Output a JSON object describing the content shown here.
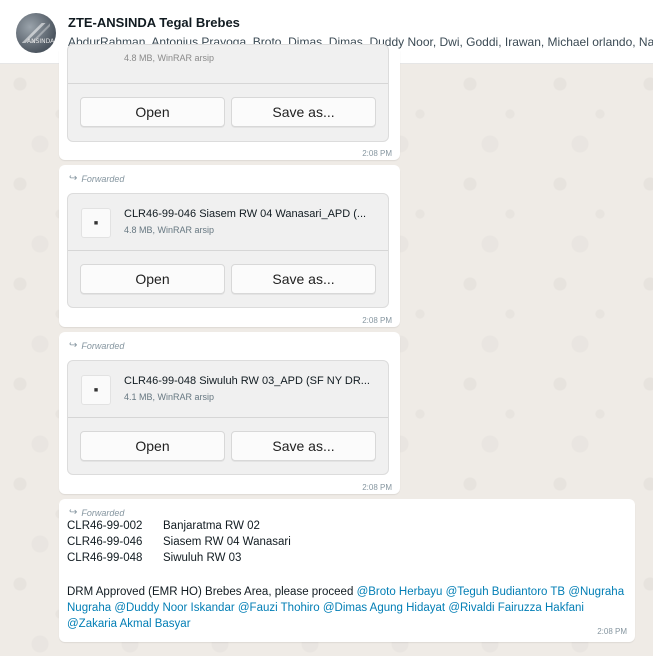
{
  "header": {
    "title": "ZTE-ANSINDA Tegal Brebes",
    "members": "AbdurRahman, Antonius Prayoga, Broto, Dimas, Dimas, Duddy Noor, Dwi, Goddi, Irawan, Michael orlando, Nad",
    "avatar_text": "ANSINDA"
  },
  "messages": [
    {
      "forwarded_label": "",
      "file_name": "",
      "file_meta": "4.8 MB, WinRAR arsip",
      "open_label": "Open",
      "save_label": "Save as...",
      "time": "2:08 PM"
    },
    {
      "forwarded_label": "Forwarded",
      "file_name": "CLR46-99-046 Siasem RW 04 Wanasari_APD (...",
      "file_meta": "4.8 MB, WinRAR arsip",
      "open_label": "Open",
      "save_label": "Save as...",
      "time": "2:08 PM"
    },
    {
      "forwarded_label": "Forwarded",
      "file_name": "CLR46-99-048 Siwuluh RW 03_APD (SF NY DR...",
      "file_meta": "4.1 MB, WinRAR arsip",
      "open_label": "Open",
      "save_label": "Save as...",
      "time": "2:08 PM"
    }
  ],
  "text_message": {
    "forwarded_label": "Forwarded",
    "rows": [
      {
        "code": "CLR46-99-002",
        "name": "Banjaratma RW 02"
      },
      {
        "code": "CLR46-99-046",
        "name": "Siasem RW 04 Wanasari"
      },
      {
        "code": "CLR46-99-048",
        "name": "Siwuluh RW 03"
      }
    ],
    "body_text": "DRM Approved (EMR HO) Brebes Area, please proceed",
    "mentions": [
      "@Broto Herbayu",
      "@Teguh Budiantoro TB",
      "@Nugraha Nugraha",
      "@Duddy Noor Iskandar",
      "@Fauzi Thohiro",
      "@Dimas Agung Hidayat",
      "@Rivaldi Fairuzza Hakfani",
      "@Zakaria Akmal Basyar"
    ],
    "time": "2:08 PM"
  }
}
